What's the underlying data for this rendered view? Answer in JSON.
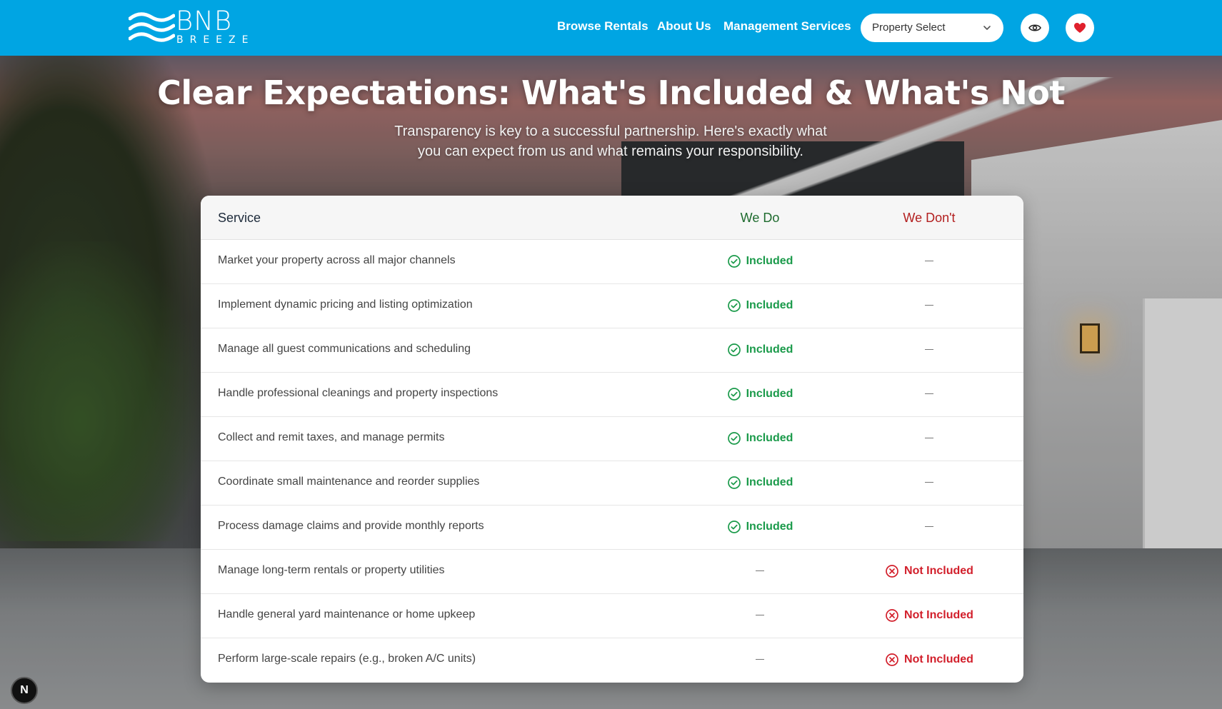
{
  "brand": {
    "name": "BNB",
    "tagline": "BREEZE"
  },
  "nav": {
    "links": [
      "Browse Rentals",
      "About Us",
      "Management Services"
    ],
    "property_select": "Property Select"
  },
  "icons": {
    "eye": "eye-icon",
    "heart": "heart-icon",
    "chevron": "chevron-down-icon",
    "check": "check-circle-icon",
    "x": "x-circle-icon"
  },
  "colors": {
    "header": "#00a5e3",
    "included": "#1a9a4a",
    "not_included": "#d21f2b",
    "we_do": "#1e6b2e",
    "we_dont": "#b32020"
  },
  "hero": {
    "title": "Clear Expectations: What's Included & What's Not",
    "subtitle_line1": "Transparency is key to a successful partnership. Here's exactly what",
    "subtitle_line2": "you can expect from us and what remains your responsibility."
  },
  "table": {
    "headers": {
      "service": "Service",
      "we_do": "We Do",
      "we_dont": "We Don't"
    },
    "included_label": "Included",
    "not_included_label": "Not Included",
    "rows": [
      {
        "service": "Market your property across all major channels",
        "included": true
      },
      {
        "service": "Implement dynamic pricing and listing optimization",
        "included": true
      },
      {
        "service": "Manage all guest communications and scheduling",
        "included": true
      },
      {
        "service": "Handle professional cleanings and property inspections",
        "included": true
      },
      {
        "service": "Collect and remit taxes, and manage permits",
        "included": true
      },
      {
        "service": "Coordinate small maintenance and reorder supplies",
        "included": true
      },
      {
        "service": "Process damage claims and provide monthly reports",
        "included": true
      },
      {
        "service": "Manage long-term rentals or property utilities",
        "included": false
      },
      {
        "service": "Handle general yard maintenance or home upkeep",
        "included": false
      },
      {
        "service": "Perform large-scale repairs (e.g., broken A/C units)",
        "included": false
      }
    ]
  },
  "dev_badge": "N"
}
